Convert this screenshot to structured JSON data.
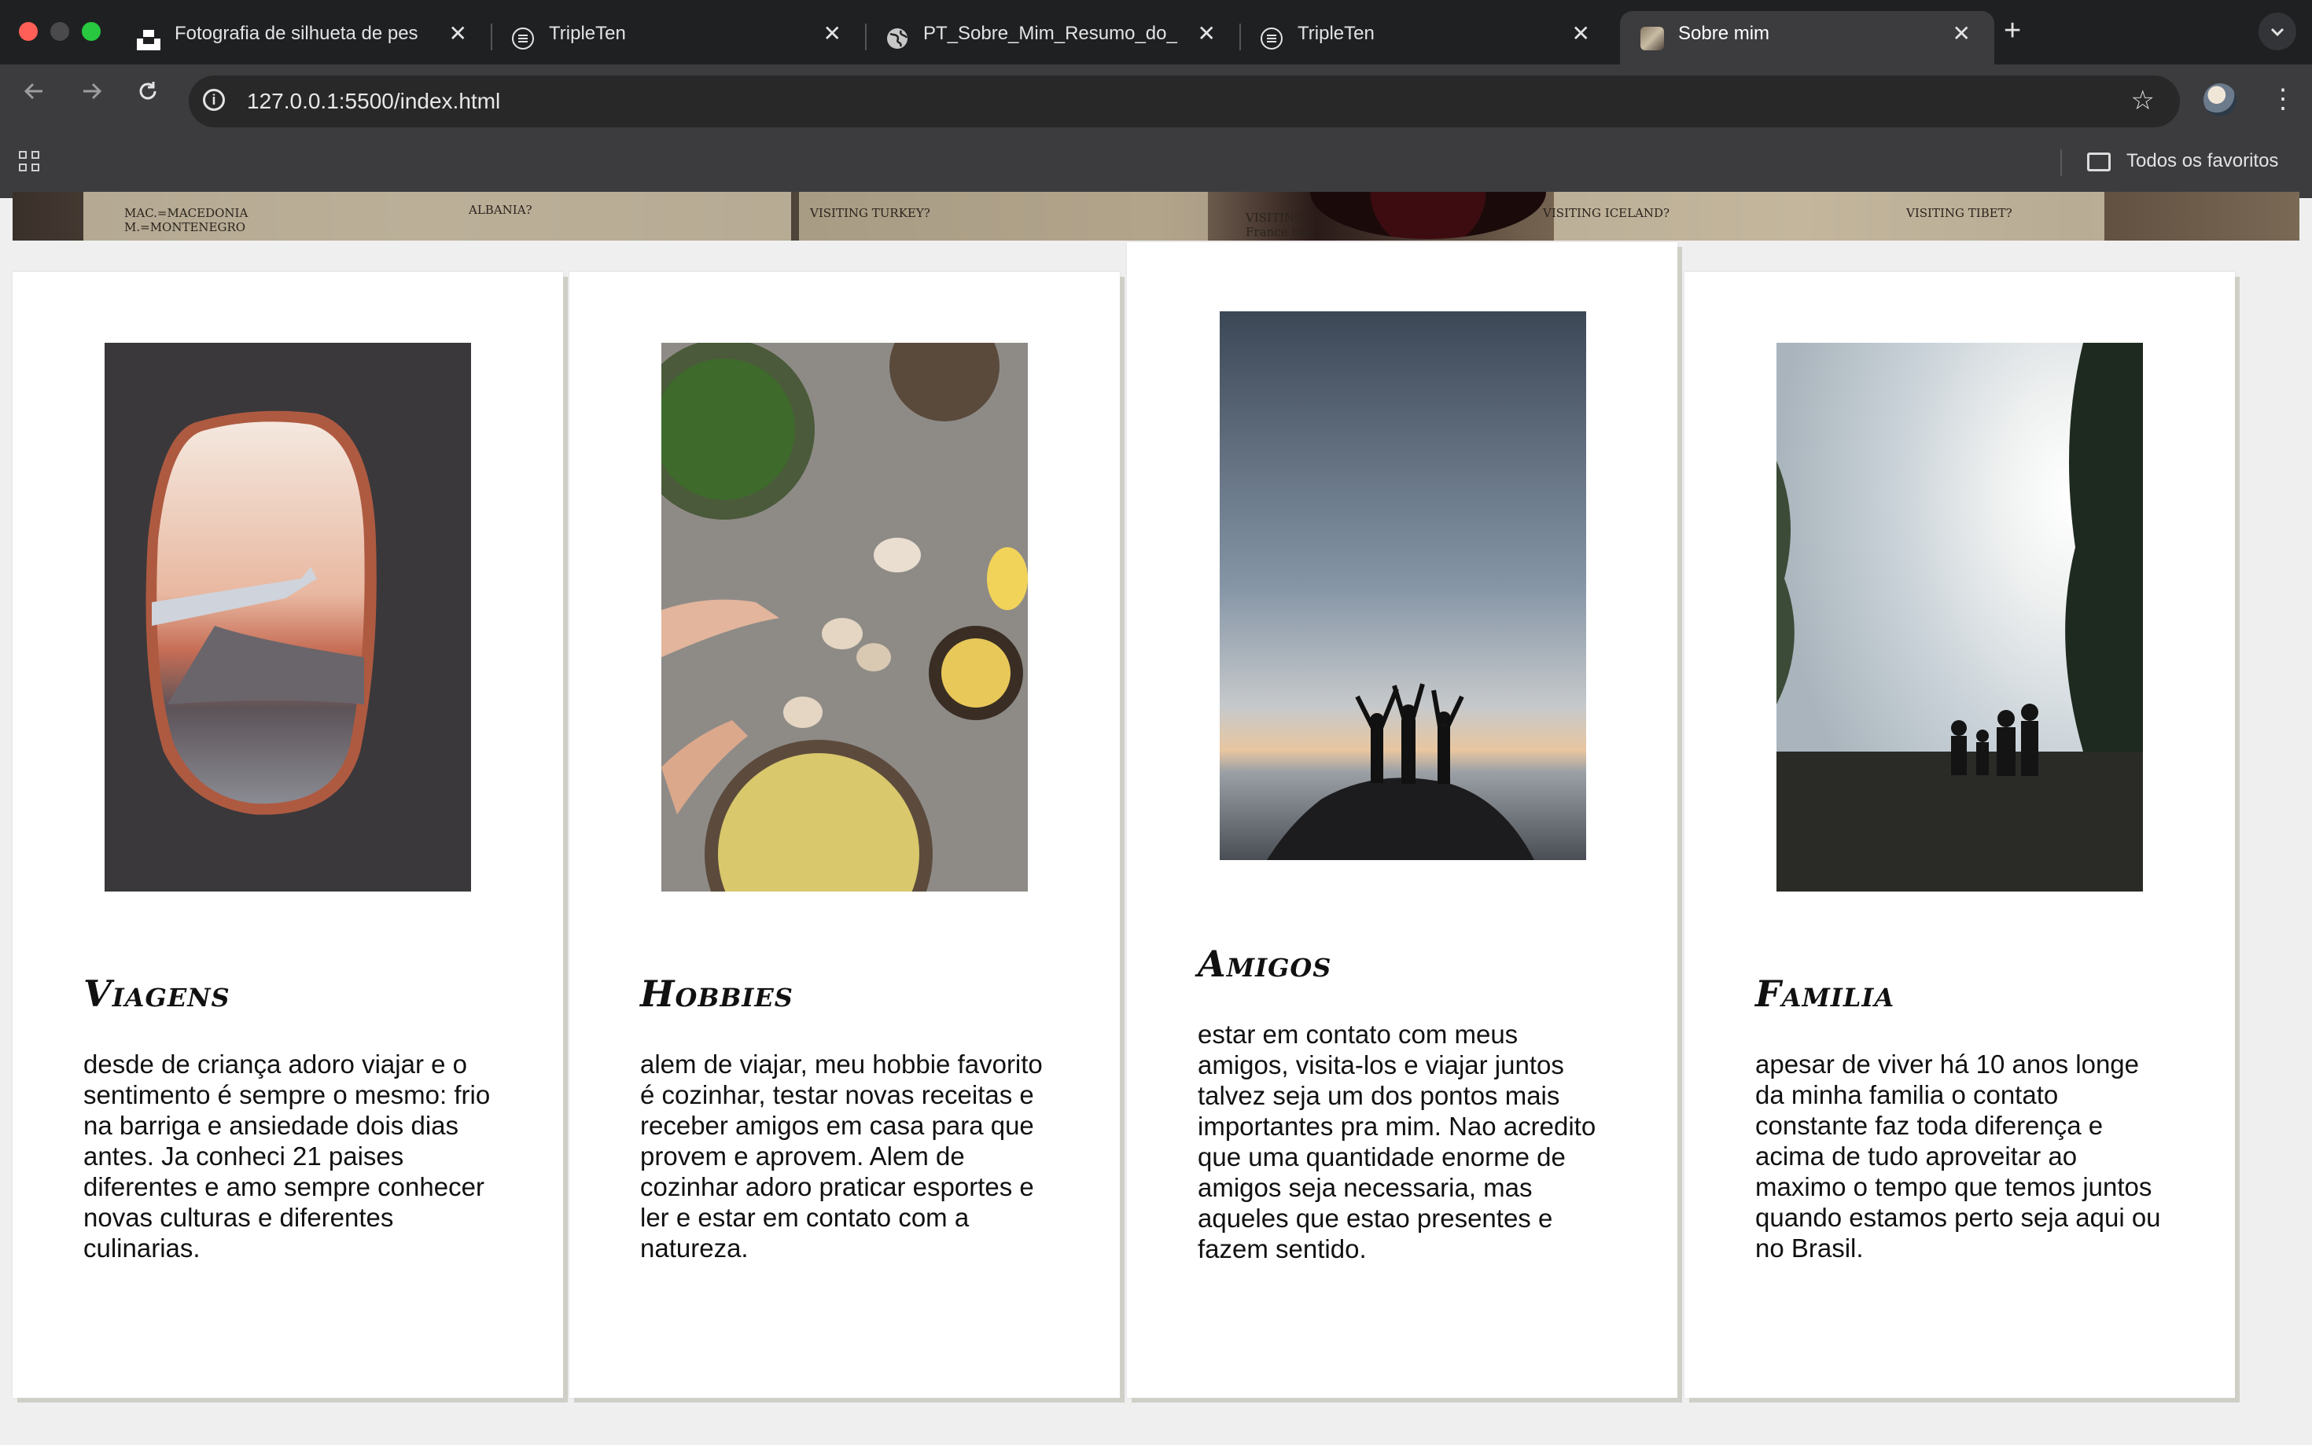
{
  "browser": {
    "tabs": [
      {
        "title": "Fotografia de silhueta de pes",
        "favicon": "unsplash-icon",
        "active": false
      },
      {
        "title": "TripleTen",
        "favicon": "tripleten-icon",
        "active": false
      },
      {
        "title": "PT_Sobre_Mim_Resumo_do_",
        "favicon": "globe-icon",
        "active": false
      },
      {
        "title": "TripleTen",
        "favicon": "tripleten-icon",
        "active": false
      },
      {
        "title": "Sobre mim",
        "favicon": "site-icon",
        "active": true
      }
    ],
    "close_glyph": "✕",
    "new_tab_glyph": "+",
    "url": "127.0.0.1:5500/index.html",
    "bookmarks_label": "Todos os favoritos"
  },
  "hero": {
    "notes": [
      "MAC.=MACEDONIA",
      "M.=MONTENEGRO",
      "VISITING TURKEY?",
      "VISITING",
      "France has",
      "VISITING ICELAND?",
      "VISITING TIBET?",
      "ALBANIA?"
    ]
  },
  "cards": [
    {
      "title": "Viagens",
      "text": "desde de criança adoro viajar e o sentimento é sempre o mesmo: frio na barriga e ansiedade dois dias antes. Ja conheci 21 paises diferentes e amo sempre conhecer novas culturas e diferentes culinarias."
    },
    {
      "title": "Hobbies",
      "text": "alem de viajar, meu hobbie favorito é cozinhar, testar novas receitas e receber amigos em casa para que provem e aprovem. Alem de cozinhar adoro praticar esportes e ler e estar em contato com a natureza."
    },
    {
      "title": "Amigos",
      "text": "estar em contato com meus amigos, visita-los e viajar juntos talvez seja um dos pontos mais importantes pra mim. Nao acredito que uma quantidade enorme de amigos seja necessaria, mas aqueles que estao presentes e fazem sentido."
    },
    {
      "title": "Familia",
      "text": "apesar de viver há 10 anos longe da minha familia o contato constante faz toda diferença e acima de tudo aproveitar ao maximo o tempo que temos juntos quando estamos perto seja aqui ou no Brasil."
    }
  ]
}
